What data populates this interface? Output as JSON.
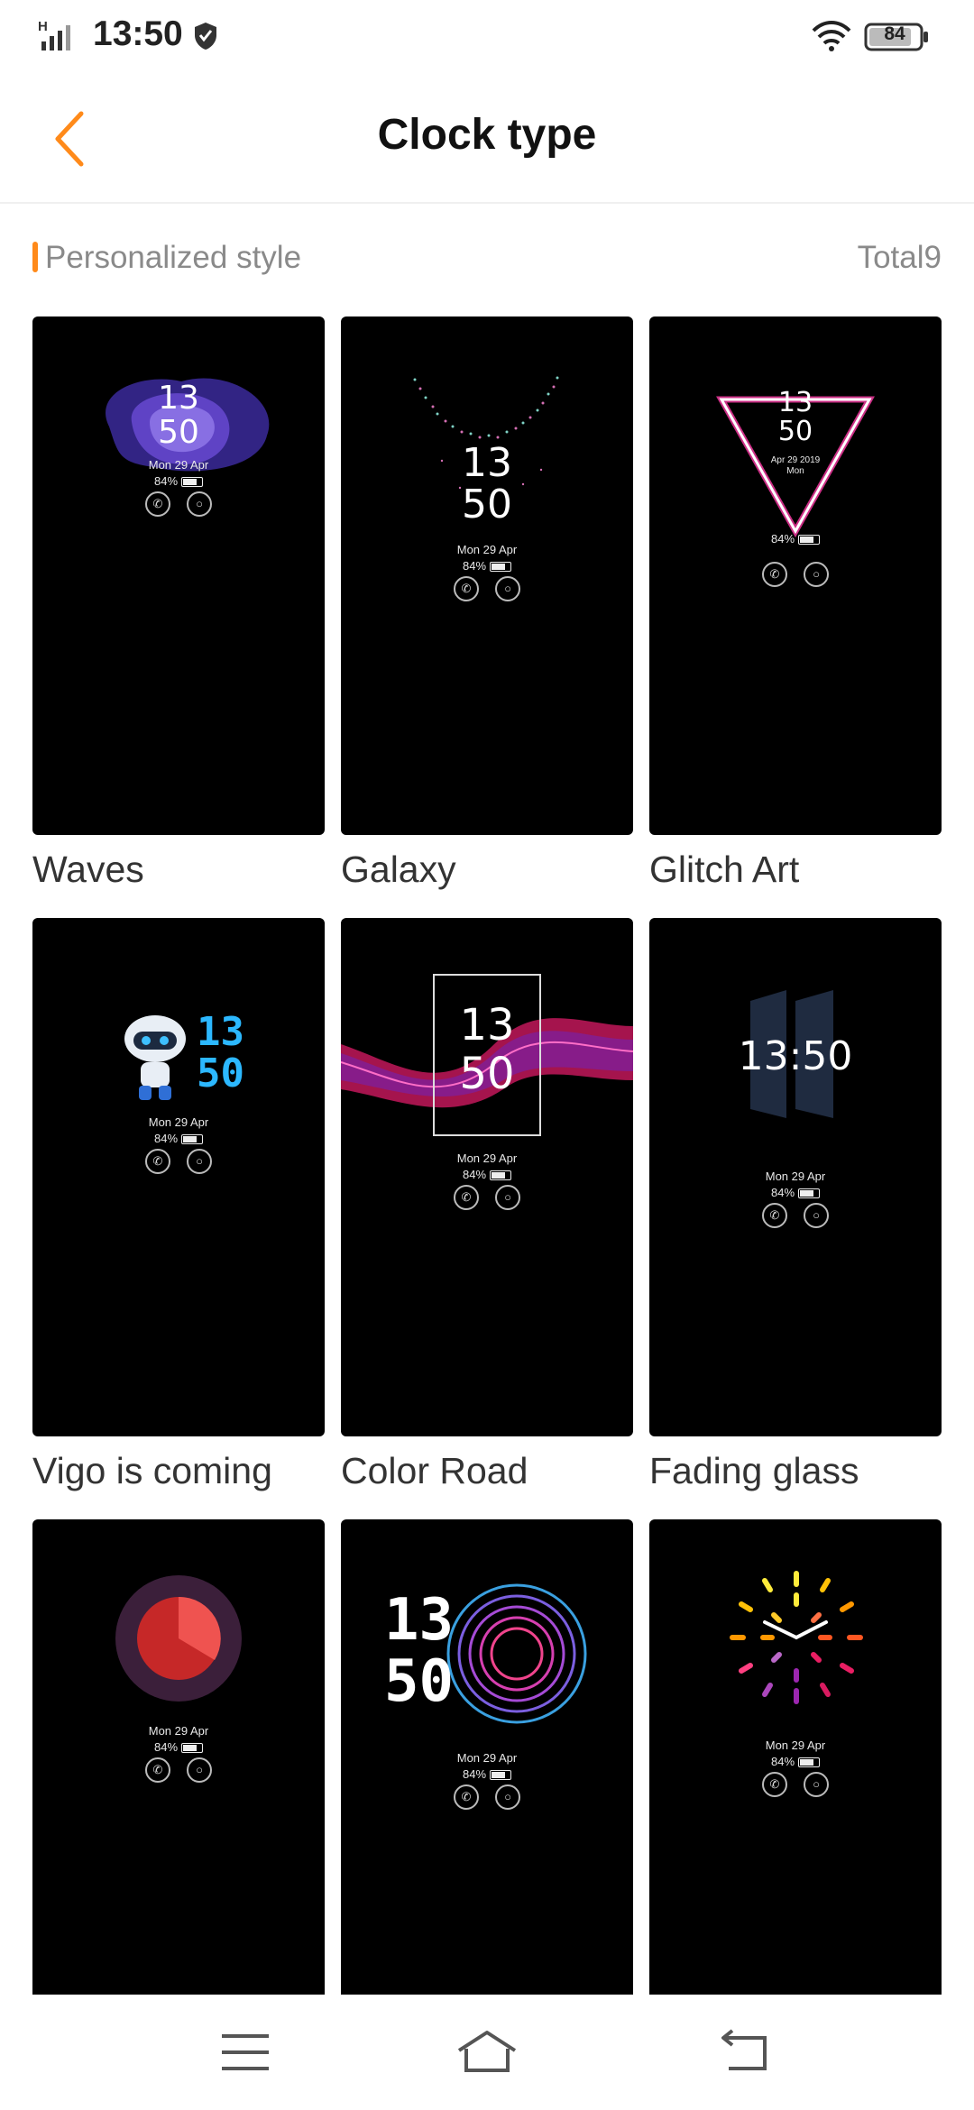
{
  "status": {
    "time": "13:50",
    "battery": "84",
    "network": "H"
  },
  "header": {
    "title": "Clock type"
  },
  "section": {
    "title": "Personalized style",
    "total": "Total9"
  },
  "cards": [
    {
      "label": "Waves",
      "hour": "13",
      "minute": "50",
      "date": "Mon 29 Apr",
      "battery": "84%"
    },
    {
      "label": "Galaxy",
      "hour": "13",
      "minute": "50",
      "date": "Mon 29 Apr",
      "battery": "84%"
    },
    {
      "label": "Glitch Art",
      "hour": "13",
      "minute": "50",
      "date": "Apr 29 2019",
      "day": "Mon",
      "battery": "84%"
    },
    {
      "label": "Vigo is coming",
      "hour": "13",
      "minute": "50",
      "date": "Mon 29 Apr",
      "battery": "84%"
    },
    {
      "label": "Color Road",
      "hour": "13",
      "minute": "50",
      "date": "Mon 29 Apr",
      "battery": "84%"
    },
    {
      "label": "Fading glass",
      "time": "13:50",
      "date": "Mon 29 Apr",
      "battery": "84%"
    },
    {
      "label": "",
      "date": "Mon 29 Apr",
      "battery": "84%"
    },
    {
      "label": "",
      "hour": "13",
      "minute": "50",
      "date": "Mon 29 Apr",
      "battery": "84%"
    },
    {
      "label": "",
      "date": "Mon 29 Apr",
      "battery": "84%"
    }
  ],
  "icons": {
    "back": "chevron-left-icon",
    "menu": "menu-icon",
    "home": "home-icon",
    "return": "back-icon"
  },
  "colors": {
    "accent": "#ff8a1a",
    "thumb_bg": "#000000"
  }
}
